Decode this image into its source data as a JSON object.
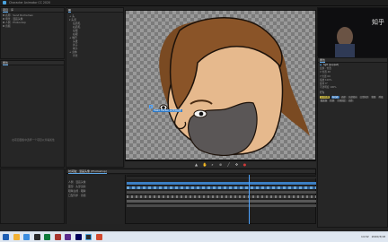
{
  "window": {
    "title": "Character Animator CC 2020"
  },
  "left_panel": {
    "tabs": [
      "项目",
      "库"
    ],
    "tree": [
      "名称 · Sand Rocheman",
      "场景 · 漫画头像",
      "人偶 · Photoshop",
      "音频"
    ],
    "props_title": "属性",
    "props_empty": "在项目面板中选择一个项目以查看属性"
  },
  "puppet_panel": {
    "items": [
      "+ 头",
      "▾ 头部",
      "左眉毛",
      "右眉毛",
      "左眼",
      "右眼",
      "+ 嘴巴",
      "头发",
      "鼻子",
      "胡子",
      "+ 身体",
      "背景"
    ]
  },
  "canvas": {
    "label": "漫画头像",
    "callout": "Head Tracker 头部追踪器"
  },
  "right_panel": {
    "header": "属性",
    "selected": "Sg8 (puppet)",
    "rows": [
      "变换 · 位置",
      "X 位置 48",
      "Y 位置 60",
      "缩放 100%",
      "旋转 0°",
      "不透明度 100%"
    ],
    "behaviors_title": "行为",
    "chips": [
      [
        "自动眨眼",
        "yellow"
      ],
      [
        "拖动器",
        "blue"
      ],
      [
        "面部",
        "gray"
      ],
      [
        "头部转向",
        "gray"
      ],
      [
        "口型同步",
        "gray"
      ],
      [
        "物理",
        "gray"
      ],
      [
        "呼吸",
        "gray"
      ],
      [
        "触发器",
        "gray"
      ],
      [
        "转换",
        "gray"
      ],
      [
        "手柄固定",
        "gray"
      ],
      [
        "动作",
        "gray"
      ]
    ],
    "accent_color": "#2b6fb8"
  },
  "timeline": {
    "tab": "时间轴：漫画头像 (Photoshop)",
    "track_labels": [
      "人偶 · 漫画头像",
      "面部 · 头部追踪",
      "眼睛注视 · 眼睛",
      "口型同步 · 音频"
    ]
  },
  "taskbar": {
    "clock": "14:32",
    "date": "2020/3/18"
  },
  "watermark": "知乎"
}
